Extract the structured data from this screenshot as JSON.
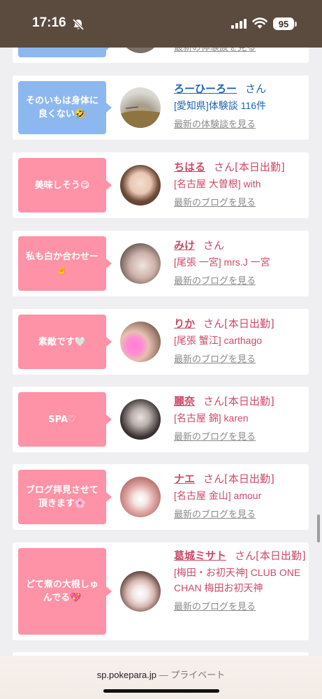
{
  "status": {
    "time": "17:16",
    "battery": "95"
  },
  "browser": {
    "domain": "sp.pokepara.jp",
    "separator": "—",
    "mode": "プライベート"
  },
  "partial_top": {
    "link": "最新の体験談を見る"
  },
  "cards": [
    {
      "type": "review",
      "bubble": "そのいもは身体に良くない🤣",
      "name": "ろーひーろー",
      "san": "さん",
      "detail": "[愛知県]体験談 116件",
      "link": "最新の体験談を見る",
      "bubble_color": "#8db8ef"
    },
    {
      "type": "blog",
      "bubble": "美味しそう😋",
      "name": "ちはる",
      "san": "さん[本日出勤]",
      "detail": "[名古屋 大曽根] with",
      "link": "最新のブログを見る"
    },
    {
      "type": "blog",
      "bubble": "私も白か合わせー☝️",
      "name": "みけ",
      "san": "さん",
      "detail": "[尾張 一宮] mrs.J 一宮",
      "link": "最新のブログを見る"
    },
    {
      "type": "blog",
      "bubble": "素敵です🤍",
      "name": "りか",
      "san": "さん[本日出勤]",
      "detail": "[尾張 蟹江] carthago",
      "link": "最新のブログを見る"
    },
    {
      "type": "blog",
      "bubble": "SPA♡",
      "name": "麗奈",
      "san": "さん[本日出勤]",
      "detail": "[名古屋 錦] karen",
      "link": "最新のブログを見る"
    },
    {
      "type": "blog",
      "bubble": "ブログ拝見させて頂きます🌸",
      "name": "ナエ",
      "san": "さん[本日出勤]",
      "detail": "[名古屋 金山] amour",
      "link": "最新のブログを見る"
    },
    {
      "type": "blog",
      "bubble": "どて煮の大根しゅんでる💖",
      "name": "葛城ミサト",
      "san": "さん[本日出勤]",
      "detail": "[梅田・お初天神] CLUB ONE CHAN 梅田お初天神",
      "link": "最新のブログを見る"
    }
  ],
  "colors": {
    "status_bar": "#5b4a3e",
    "pink": "#fe92a6",
    "blue": "#8db8ef",
    "name_pink": "#cd4a68",
    "name_blue": "#1e64b4"
  }
}
